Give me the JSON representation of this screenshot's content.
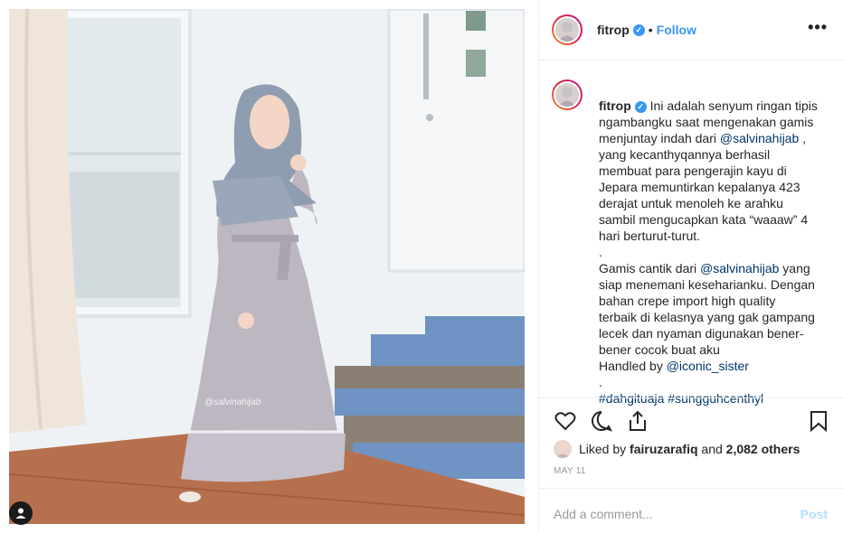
{
  "post": {
    "username": "fitrop",
    "verified_mark": "✓",
    "separator": "•",
    "follow_label": "Follow",
    "more_label": "•••",
    "photo_watermark": "@salvinahijab",
    "caption_lines": [
      {
        "t": "Ini adalah senyum ringan tipis\nngambangku saat mengenakan gamis\nmenjuntay indah dari "
      },
      {
        "l": "@salvinahijab"
      },
      {
        "t": " ,\nyang kecanthyqannya berhasil\nmembuat para pengerajin kayu di\nJepara memuntirkan kepalanya 423\nderajat untuk menoleh ke arahku\nsambil mengucapkan kata “waaaw” 4\nhari berturut-turut.\n.\nGamis cantik dari "
      },
      {
        "l": "@salvinahijab"
      },
      {
        "t": " yang\nsiap menemani keseharianku. Dengan\nbahan crepe import high quality\nterbaik di kelasnya yang gak gampang\nlecek dan nyaman digunakan bener-\nbener cocok buat aku\nHandled by "
      },
      {
        "l": "@iconic_sister"
      },
      {
        "t": "\n.\n"
      },
      {
        "l": "#dahgituaja"
      },
      {
        "t": " "
      },
      {
        "l": "#sungguhcenthyl"
      }
    ],
    "liked_by_prefix": "Liked by",
    "liked_by_user": "fairuzarafiq",
    "liked_by_and": "and",
    "liked_by_count": "2,082 others",
    "date": "MAY 11",
    "comment_placeholder": "Add a comment...",
    "post_button": "Post"
  },
  "icons": [
    "heart-icon",
    "comment-icon",
    "share-icon",
    "bookmark-icon",
    "user-tag-icon",
    "verified-badge-icon"
  ],
  "colors": {
    "accent": "#3897f0",
    "link": "#003569",
    "muted": "#999999",
    "post_disabled": "#b2dffc"
  }
}
